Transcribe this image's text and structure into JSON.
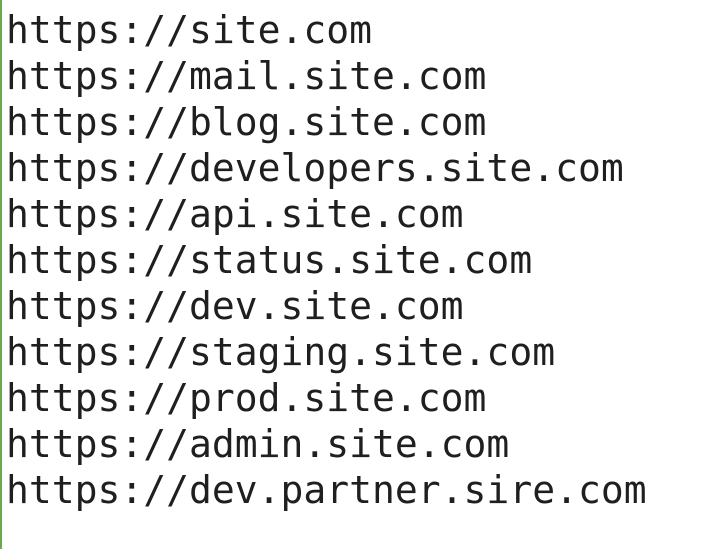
{
  "editor": {
    "lines": [
      "https://site.com",
      "https://mail.site.com",
      "https://blog.site.com",
      "https://developers.site.com",
      "https://api.site.com",
      "https://status.site.com",
      "https://dev.site.com",
      "https://staging.site.com",
      "https://prod.site.com",
      "https://admin.site.com",
      "https://dev.partner.sire.com"
    ]
  },
  "colors": {
    "background": "#ffffff",
    "text": "#1f1f1f",
    "left_border": "#6aa84f"
  }
}
